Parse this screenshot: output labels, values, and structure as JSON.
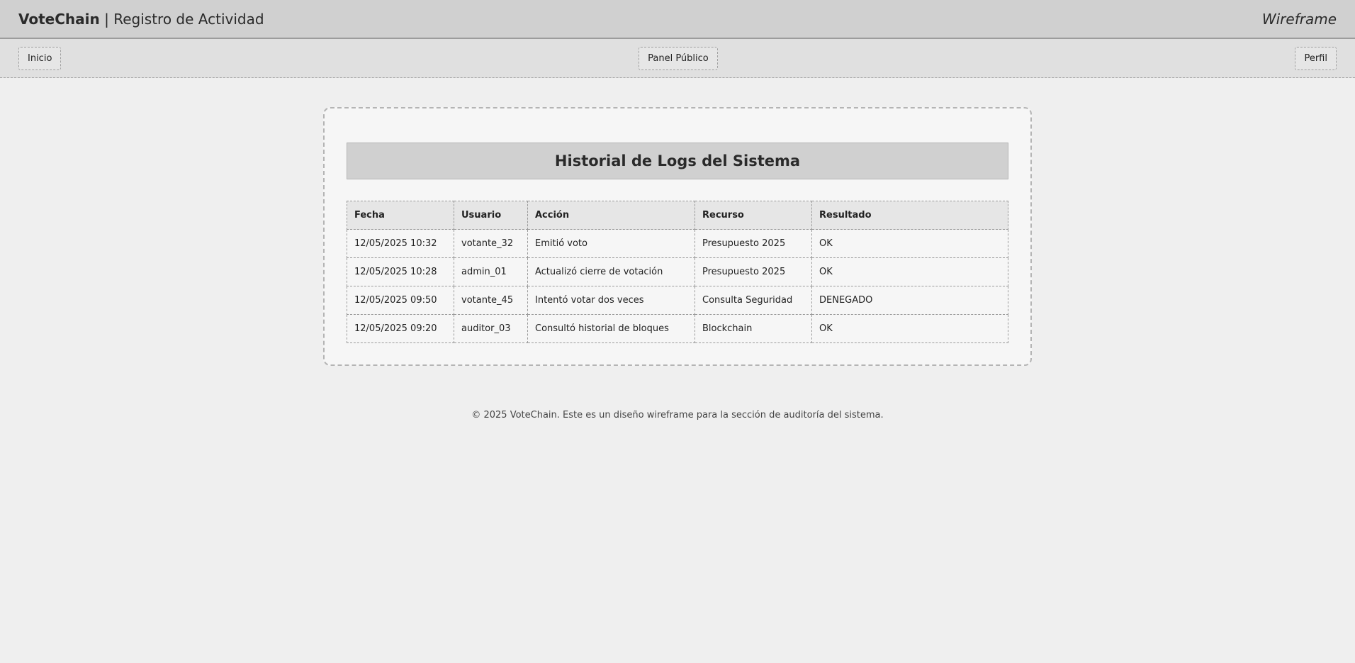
{
  "header": {
    "brand_name": "VoteChain",
    "separator": "|",
    "section": "Registro de Actividad",
    "wireframe_label": "Wireframe"
  },
  "nav": {
    "home": "Inicio",
    "public_panel": "Panel Público",
    "profile": "Perfil"
  },
  "main": {
    "title": "Historial de Logs del Sistema",
    "columns": [
      "Fecha",
      "Usuario",
      "Acción",
      "Recurso",
      "Resultado"
    ],
    "rows": [
      [
        "12/05/2025 10:32",
        "votante_32",
        "Emitió voto",
        "Presupuesto 2025",
        "OK"
      ],
      [
        "12/05/2025 10:28",
        "admin_01",
        "Actualizó cierre de votación",
        "Presupuesto 2025",
        "OK"
      ],
      [
        "12/05/2025 09:50",
        "votante_45",
        "Intentó votar dos veces",
        "Consulta Seguridad",
        "DENEGADO"
      ],
      [
        "12/05/2025 09:20",
        "auditor_03",
        "Consultó historial de bloques",
        "Blockchain",
        "OK"
      ]
    ]
  },
  "footer": {
    "text": "© 2025 VoteChain. Este es un diseño wireframe para la sección de auditoría del sistema."
  }
}
